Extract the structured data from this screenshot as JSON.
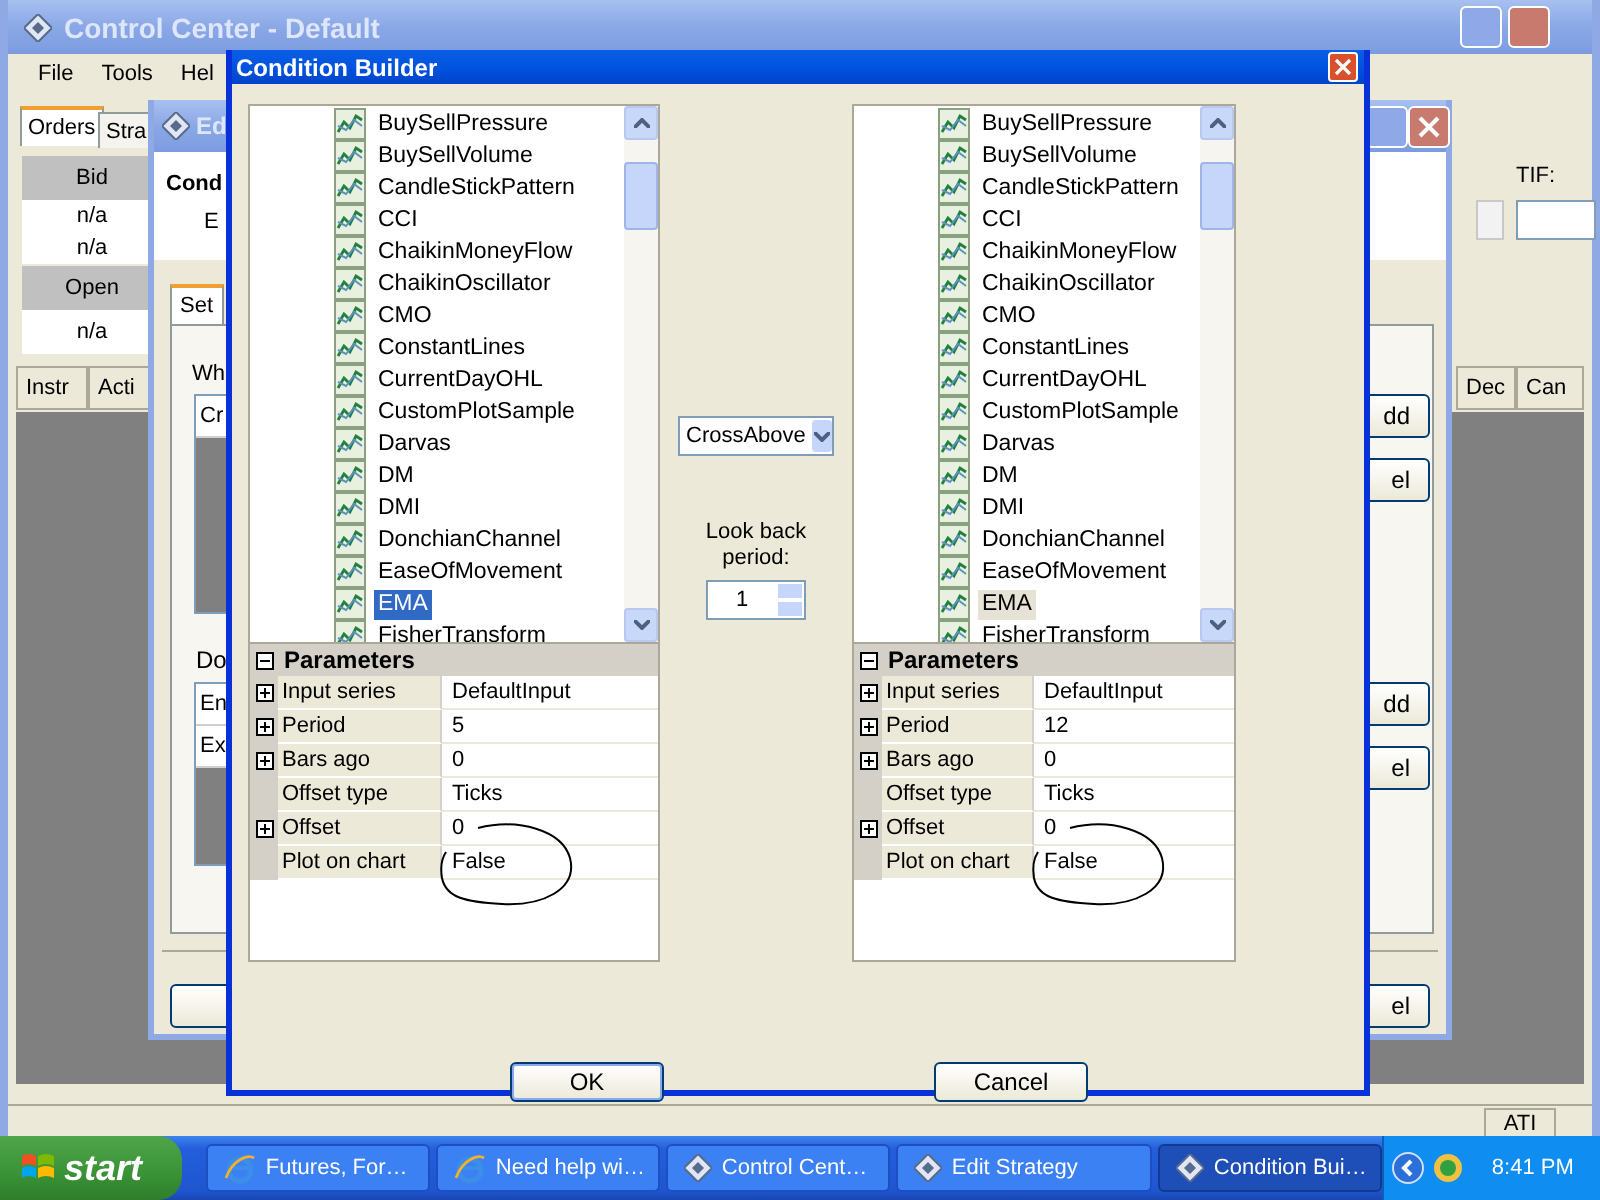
{
  "control_center": {
    "title": "Control Center - Default",
    "menu": [
      "File",
      "Tools",
      "Hel"
    ],
    "tabs": [
      {
        "label": "Orders",
        "selected": true
      },
      {
        "label": "Stra",
        "selected": false
      }
    ],
    "quote_table": [
      {
        "kind": "header",
        "text": "Bid"
      },
      {
        "kind": "cell",
        "text": "n/a"
      },
      {
        "kind": "cell",
        "text": "n/a"
      },
      {
        "kind": "header",
        "text": "Open"
      },
      {
        "kind": "cell",
        "text": "n/a"
      }
    ],
    "columns_left": [
      "Instr",
      "Acti"
    ],
    "tif_label": "TIF:",
    "columns_right": [
      "Dec",
      "Can"
    ],
    "status_bar": {
      "panel": "ATI"
    }
  },
  "edit_strategy": {
    "title": "Ed",
    "heading": "Cond",
    "line": "E",
    "tabs": [
      {
        "label": "Set",
        "selected": true
      }
    ],
    "when_label": "Wh",
    "conditions": [
      "Cr"
    ],
    "do_label": "Do",
    "actions": [
      "En",
      "Ex"
    ],
    "side_buttons": [
      "dd",
      "el",
      "dd",
      "el"
    ],
    "bottom_button": "el"
  },
  "condition_builder": {
    "title": "Condition Builder",
    "panels": [
      {
        "focused": true,
        "items": [
          {
            "name": "BuySellPressure",
            "selected": false
          },
          {
            "name": "BuySellVolume",
            "selected": false
          },
          {
            "name": "CandleStickPattern",
            "selected": false
          },
          {
            "name": "CCI",
            "selected": false
          },
          {
            "name": "ChaikinMoneyFlow",
            "selected": false
          },
          {
            "name": "ChaikinOscillator",
            "selected": false
          },
          {
            "name": "CMO",
            "selected": false
          },
          {
            "name": "ConstantLines",
            "selected": false
          },
          {
            "name": "CurrentDayOHL",
            "selected": false
          },
          {
            "name": "CustomPlotSample",
            "selected": false
          },
          {
            "name": "Darvas",
            "selected": false
          },
          {
            "name": "DM",
            "selected": false
          },
          {
            "name": "DMI",
            "selected": false
          },
          {
            "name": "DonchianChannel",
            "selected": false
          },
          {
            "name": "EaseOfMovement",
            "selected": false
          },
          {
            "name": "EMA",
            "selected": true
          },
          {
            "name": "FisherTransform",
            "selected": false
          }
        ],
        "parameters": {
          "title": "Parameters",
          "expanded": true,
          "rows": [
            {
              "name": "Input series",
              "value": "DefaultInput",
              "expandable": true,
              "circled": false
            },
            {
              "name": "Period",
              "value": "5",
              "expandable": true,
              "circled": false
            },
            {
              "name": "Bars ago",
              "value": "0",
              "expandable": true,
              "circled": false
            },
            {
              "name": "Offset type",
              "value": "Ticks",
              "expandable": false,
              "circled": false
            },
            {
              "name": "Offset",
              "value": "0",
              "expandable": true,
              "circled": false
            },
            {
              "name": "Plot on chart",
              "value": "False",
              "expandable": false,
              "circled": true
            }
          ]
        }
      },
      {
        "focused": false,
        "items": [
          {
            "name": "BuySellPressure",
            "selected": false
          },
          {
            "name": "BuySellVolume",
            "selected": false
          },
          {
            "name": "CandleStickPattern",
            "selected": false
          },
          {
            "name": "CCI",
            "selected": false
          },
          {
            "name": "ChaikinMoneyFlow",
            "selected": false
          },
          {
            "name": "ChaikinOscillator",
            "selected": false
          },
          {
            "name": "CMO",
            "selected": false
          },
          {
            "name": "ConstantLines",
            "selected": false
          },
          {
            "name": "CurrentDayOHL",
            "selected": false
          },
          {
            "name": "CustomPlotSample",
            "selected": false
          },
          {
            "name": "Darvas",
            "selected": false
          },
          {
            "name": "DM",
            "selected": false
          },
          {
            "name": "DMI",
            "selected": false
          },
          {
            "name": "DonchianChannel",
            "selected": false
          },
          {
            "name": "EaseOfMovement",
            "selected": false
          },
          {
            "name": "EMA",
            "selected": true
          },
          {
            "name": "FisherTransform",
            "selected": false
          }
        ],
        "parameters": {
          "title": "Parameters",
          "expanded": true,
          "rows": [
            {
              "name": "Input series",
              "value": "DefaultInput",
              "expandable": true,
              "circled": false
            },
            {
              "name": "Period",
              "value": "12",
              "expandable": true,
              "circled": false
            },
            {
              "name": "Bars ago",
              "value": "0",
              "expandable": true,
              "circled": false
            },
            {
              "name": "Offset type",
              "value": "Ticks",
              "expandable": false,
              "circled": false
            },
            {
              "name": "Offset",
              "value": "0",
              "expandable": true,
              "circled": false
            },
            {
              "name": "Plot on chart",
              "value": "False",
              "expandable": false,
              "circled": true
            }
          ]
        }
      }
    ],
    "operator": "CrossAbove",
    "lookback_label": "Look back period:",
    "lookback": "1",
    "buttons": [
      {
        "label": "OK",
        "default": true
      },
      {
        "label": "Cancel",
        "default": false
      }
    ]
  },
  "taskbar": {
    "start": "start",
    "tasks": [
      {
        "label": "Futures, For…",
        "kind": "browser",
        "selected": false
      },
      {
        "label": "Need help wi…",
        "kind": "browser",
        "selected": false
      },
      {
        "label": "Control Cent…",
        "kind": "app",
        "selected": false
      },
      {
        "label": "Edit Strategy",
        "kind": "app",
        "selected": false
      },
      {
        "label": "Condition Bui…",
        "kind": "app",
        "selected": true
      }
    ],
    "clock": "8:41 PM"
  }
}
